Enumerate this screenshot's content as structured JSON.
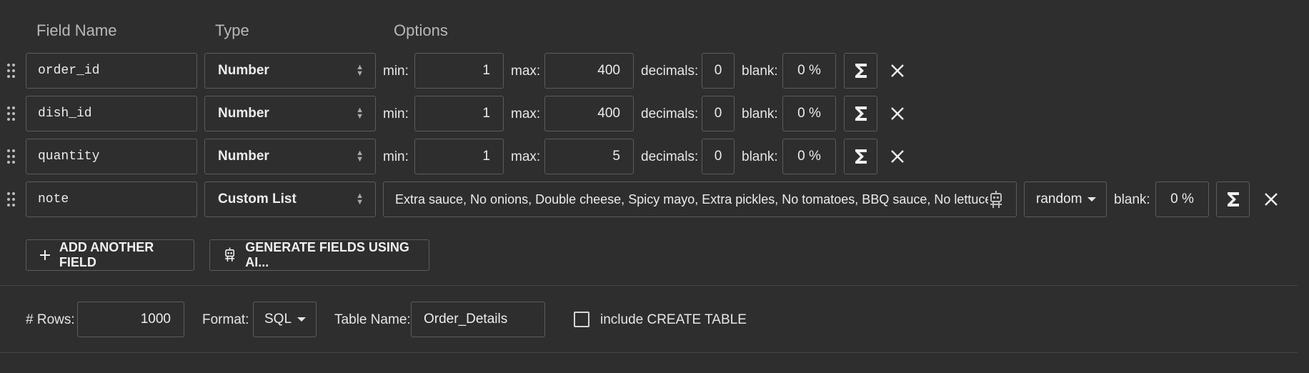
{
  "headers": {
    "field_name": "Field Name",
    "type": "Type",
    "options": "Options"
  },
  "labels": {
    "min": "min:",
    "max": "max:",
    "decimals": "decimals:",
    "blank": "blank:"
  },
  "rows": [
    {
      "name": "order_id",
      "type": "Number",
      "min": "1",
      "max": "400",
      "decimals": "0",
      "blank": "0 %"
    },
    {
      "name": "dish_id",
      "type": "Number",
      "min": "1",
      "max": "400",
      "decimals": "0",
      "blank": "0 %"
    },
    {
      "name": "quantity",
      "type": "Number",
      "min": "1",
      "max": "5",
      "decimals": "0",
      "blank": "0 %"
    }
  ],
  "custom_row": {
    "name": "note",
    "type": "Custom List",
    "values": "Extra sauce, No onions, Double cheese, Spicy mayo, Extra pickles, No tomatoes, BBQ sauce, No lettuce, R",
    "mode": "random",
    "blank": "0 %"
  },
  "actions": {
    "add_field": "ADD ANOTHER FIELD",
    "generate_ai": "GENERATE FIELDS USING AI..."
  },
  "footer": {
    "rows_label": "# Rows:",
    "rows_value": "1000",
    "format_label": "Format:",
    "format_value": "SQL",
    "table_name_label": "Table Name:",
    "table_name_value": "Order_Details",
    "include_create_label": "include CREATE TABLE",
    "include_create_checked": false
  },
  "icons": {
    "drag": "drag-handle-icon",
    "formula": "sigma-icon",
    "remove": "close-icon",
    "ai": "robot-icon",
    "add": "plus-icon"
  }
}
